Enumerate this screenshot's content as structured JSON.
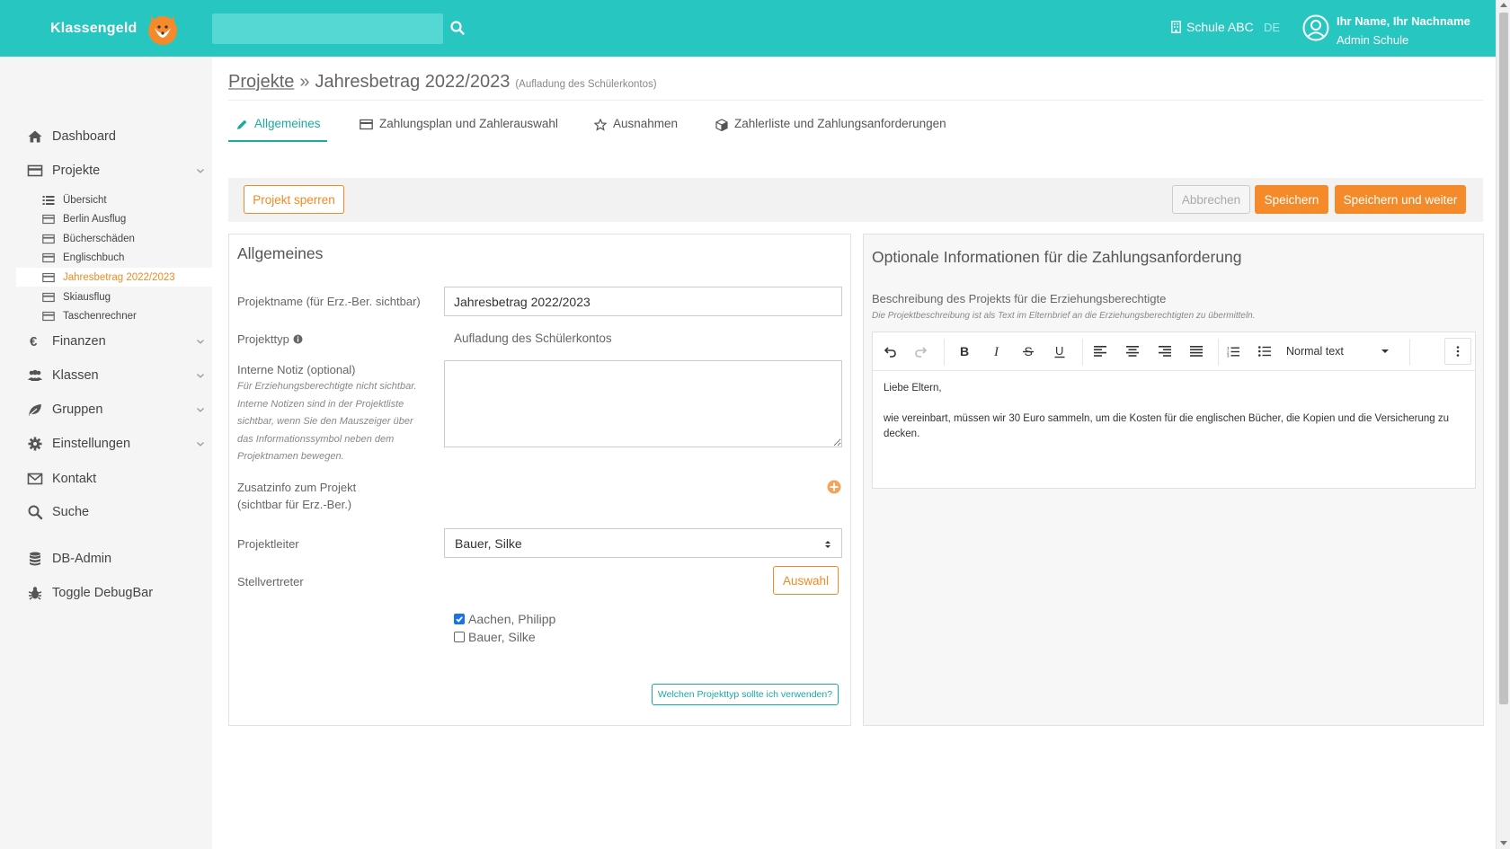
{
  "header": {
    "brand": "Klassengeld",
    "search_placeholder": "",
    "school": "Schule ABC",
    "language": "DE",
    "user_name": "Ihr Name, Ihr Nachname",
    "user_role": "Admin Schule"
  },
  "sidebar": {
    "items": [
      {
        "label": "Dashboard",
        "icon": "home-icon"
      },
      {
        "label": "Projekte",
        "icon": "card-icon"
      },
      {
        "label": "Finanzen",
        "icon": "euro-icon"
      },
      {
        "label": "Klassen",
        "icon": "users-icon"
      },
      {
        "label": "Gruppen",
        "icon": "leaf-icon"
      },
      {
        "label": "Einstellungen",
        "icon": "gear-icon"
      },
      {
        "label": "Kontakt",
        "icon": "envelope-icon"
      },
      {
        "label": "Suche",
        "icon": "search-icon"
      },
      {
        "label": "DB-Admin",
        "icon": "database-icon"
      },
      {
        "label": "Toggle DebugBar",
        "icon": "bug-icon"
      }
    ],
    "projects": [
      {
        "label": "Übersicht"
      },
      {
        "label": "Berlin Ausflug"
      },
      {
        "label": "Bücherschäden"
      },
      {
        "label": "Englischbuch"
      },
      {
        "label": "Jahresbetrag 2022/2023",
        "active": true
      },
      {
        "label": "Skiausflug"
      },
      {
        "label": "Taschenrechner"
      }
    ]
  },
  "breadcrumb": {
    "parent": "Projekte",
    "separator": "»",
    "title": "Jahresbetrag 2022/2023",
    "subtitle": "(Aufladung des Schülerkontos)"
  },
  "tabs": [
    {
      "label": "Allgemeines",
      "active": true
    },
    {
      "label": "Zahlungsplan und Zahlerauswahl"
    },
    {
      "label": "Ausnahmen"
    },
    {
      "label": "Zahlerliste und Zahlungsanforderungen"
    }
  ],
  "toolbar": {
    "lock_label": "Projekt sperren",
    "cancel_label": "Abbrechen",
    "save_label": "Speichern",
    "save_next_label": "Speichern und weiter"
  },
  "general": {
    "title": "Allgemeines",
    "name_label": "Projektname (für Erz.-Ber. sichtbar)",
    "name_value": "Jahresbetrag 2022/2023",
    "type_label": "Projekttyp",
    "type_value": "Aufladung des Schülerkontos",
    "note_label": "Interne Notiz (optional)",
    "note_help": [
      "Für Erziehungsberechtigte nicht sichtbar.",
      "Interne Notizen sind in der Projektliste",
      "sichtbar, wenn Sie den Mauszeiger über",
      "das Informationssymbol neben dem",
      "Projektnamen bewegen."
    ],
    "note_value": "",
    "extra_label_1": "Zusatzinfo zum Projekt",
    "extra_label_2": "(sichtbar für Erz.-Ber.)",
    "leader_label": "Projektleiter",
    "leader_value": "Bauer, Silke",
    "deputy_label": "Stellvertreter",
    "deputy_button": "Auswahl",
    "deputies": [
      {
        "name": "Aachen, Philipp",
        "checked": true
      },
      {
        "name": "Bauer, Silke",
        "checked": false
      }
    ],
    "help_button": "Welchen Projekttyp sollte ich verwenden?"
  },
  "optional": {
    "title": "Optionale Informationen für die Zahlungsanforderung",
    "desc_label": "Beschreibung des Projekts für die Erziehungsberechtigte",
    "desc_help": "Die Projektbeschreibung ist als Text im Elternbrief an die Erziehungsberechtigten zu übermitteln.",
    "editor_style": "Normal text",
    "editor_text": [
      "Liebe Eltern,",
      "wie vereinbart, müssen wir 30 Euro sammeln, um die Kosten für die englischen Bücher, die Kopien und die Versicherung zu decken."
    ]
  },
  "colors": {
    "header": "#27c6c1",
    "accent_orange": "#f48a2a",
    "accent_teal": "#1aa9a4"
  }
}
